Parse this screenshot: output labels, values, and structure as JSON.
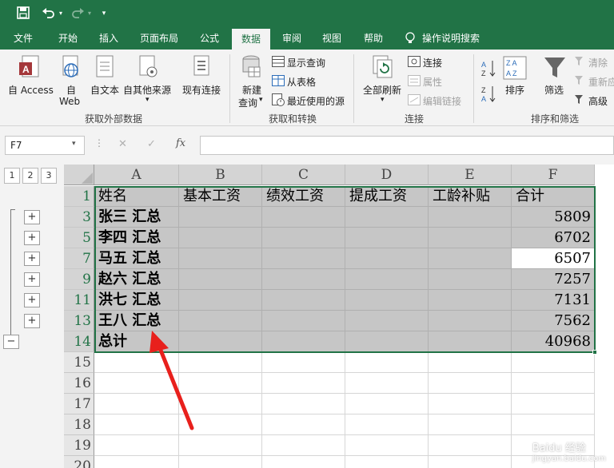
{
  "qat": {
    "save_icon": "save-icon",
    "undo_icon": "undo-icon",
    "redo_icon": "redo-icon",
    "customize_icon": "customize-qat-icon"
  },
  "tabs": [
    "文件",
    "开始",
    "插入",
    "页面布局",
    "公式",
    "数据",
    "审阅",
    "视图",
    "帮助",
    "操作说明搜索"
  ],
  "active_tab": "数据",
  "ribbon": {
    "get_external": {
      "from_access": "自 Access",
      "from_web": "自\nWeb",
      "from_web_1": "自",
      "from_web_2": "Web",
      "from_text": "自文本",
      "from_other": "自其他来源",
      "group": "获取外部数据"
    },
    "existing_conn": "现有连接",
    "transform": {
      "new_query_1": "新建",
      "new_query_2": "查询",
      "show_queries": "显示查询",
      "from_table": "从表格",
      "recent_sources": "最近使用的源",
      "group": "获取和转换"
    },
    "connections": {
      "refresh_all": "全部刷新",
      "connections": "连接",
      "properties": "属性",
      "edit_links": "编辑链接",
      "group": "连接"
    },
    "sort_filter": {
      "sort": "排序",
      "filter": "筛选",
      "clear": "清除",
      "reapply": "重新应",
      "advanced": "高级",
      "group": "排序和筛选"
    }
  },
  "formula_bar": {
    "name_box": "F7",
    "cancel": "✕",
    "enter": "✓",
    "fx": "fx",
    "formula": ""
  },
  "outline_levels": [
    "1",
    "2",
    "3"
  ],
  "columns": [
    "A",
    "B",
    "C",
    "D",
    "E",
    "F"
  ],
  "rows": [
    {
      "num": "1",
      "a": "姓名",
      "b": "基本工资",
      "c": "绩效工资",
      "d": "提成工资",
      "e": "工龄补贴",
      "f": "合计"
    },
    {
      "num": "3",
      "a": "张三  汇总",
      "f": "5809"
    },
    {
      "num": "5",
      "a": "李四  汇总",
      "f": "6702"
    },
    {
      "num": "7",
      "a": "马五  汇总",
      "f": "6507"
    },
    {
      "num": "9",
      "a": "赵六  汇总",
      "f": "7257"
    },
    {
      "num": "11",
      "a": "洪七  汇总",
      "f": "7131"
    },
    {
      "num": "13",
      "a": "王八  汇总",
      "f": "7562"
    },
    {
      "num": "14",
      "a": "总计",
      "f": "40968"
    },
    {
      "num": "15"
    },
    {
      "num": "16"
    },
    {
      "num": "17"
    },
    {
      "num": "18"
    },
    {
      "num": "19"
    },
    {
      "num": "20"
    }
  ],
  "colors": {
    "excel_green": "#217346",
    "arrow_red": "#e8201c",
    "selection_gray": "#c6c6c6"
  },
  "watermark": "Baidu 经验\njingyan.baidu.com",
  "watermark_1": "Baidu 经验",
  "watermark_2": "jingyan.baidu.com"
}
